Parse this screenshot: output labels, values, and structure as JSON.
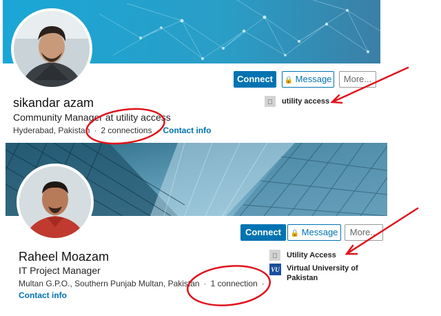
{
  "profiles": [
    {
      "name": "sikandar azam",
      "headline": "Community Manager at utility access",
      "location": "Hyderabad, Pakistan",
      "connections": "2 connections",
      "contact_info": "Contact info",
      "companies": [
        {
          "name": "utility access",
          "logo": "building-placeholder-icon"
        }
      ],
      "buttons": {
        "connect": "Connect",
        "message": "Message",
        "more": "More..."
      }
    },
    {
      "name": "Raheel Moazam",
      "headline": "IT Project Manager",
      "location": "Multan G.P.O., Southern Punjab Multan, Pakistan",
      "connections": "1 connection",
      "contact_info": "Contact info",
      "companies": [
        {
          "name": "Utility Access",
          "logo": "building-placeholder-icon"
        },
        {
          "name": "Virtual University of Pakistan",
          "logo": "vu-logo-icon"
        }
      ],
      "buttons": {
        "connect": "Connect",
        "message": "Message",
        "more": "More..."
      }
    }
  ],
  "icons": {
    "message_button": "lock-icon",
    "separator": "·"
  },
  "colors": {
    "accent": "#0073b1",
    "annotation_red": "#e0121b",
    "banner1": "#2aa3c7",
    "banner2": "#3f7591"
  }
}
